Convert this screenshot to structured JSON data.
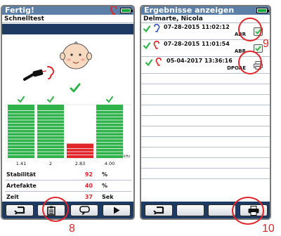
{
  "left_screen": {
    "title": "Fertig!",
    "subtitle": "Schnelltest",
    "icons": {
      "ear": "right-ear-icon",
      "battery": "battery-full-icon",
      "face": "baby-face-icon",
      "probe": "ear-probe-icon",
      "result": "pass-check-icon"
    },
    "stats": [
      {
        "label": "Stabilität",
        "value": "92",
        "unit": "%"
      },
      {
        "label": "Artefakte",
        "value": "40",
        "unit": "%"
      },
      {
        "label": "Zeit",
        "value": "37",
        "unit": "Sek"
      }
    ],
    "buttons": [
      "back-icon",
      "clipboard-icon",
      "speech-bubble-icon",
      "play-icon"
    ]
  },
  "right_screen": {
    "title": "Ergebnisse anzeigen",
    "subtitle": "Delmarte, Nicola",
    "results": [
      {
        "ear": "left",
        "date": "07-28-2015 11:02:12",
        "type": "ABR",
        "status": "document-checked-icon"
      },
      {
        "ear": "right",
        "date": "07-28-2015 11:01:54",
        "type": "ABR",
        "status": "document-checked-icon"
      },
      {
        "ear": "right",
        "date": "05-04-2017 13:36:16",
        "type": "DPOAE",
        "status": "printer-icon"
      }
    ],
    "buttons": [
      "back-icon",
      "",
      "",
      "printer-icon"
    ]
  },
  "callouts": {
    "clipboard": "8",
    "documents": "9",
    "print": "10"
  },
  "colors": {
    "title_bar": "#5b7fa6",
    "bottom_bar": "#1d3a62",
    "pass_green": "#2fb34a",
    "fail_red": "#e0252b",
    "left_ear_blue": "#3a55c8",
    "right_ear_red": "#e0252b"
  },
  "chart_data": {
    "type": "bar",
    "categories": [
      "1.41",
      "2",
      "2.83",
      "4.00"
    ],
    "values": [
      100,
      100,
      27,
      100
    ],
    "pass": [
      true,
      true,
      false,
      true
    ],
    "xunit": "kHz",
    "ylim": [
      0,
      100
    ]
  }
}
